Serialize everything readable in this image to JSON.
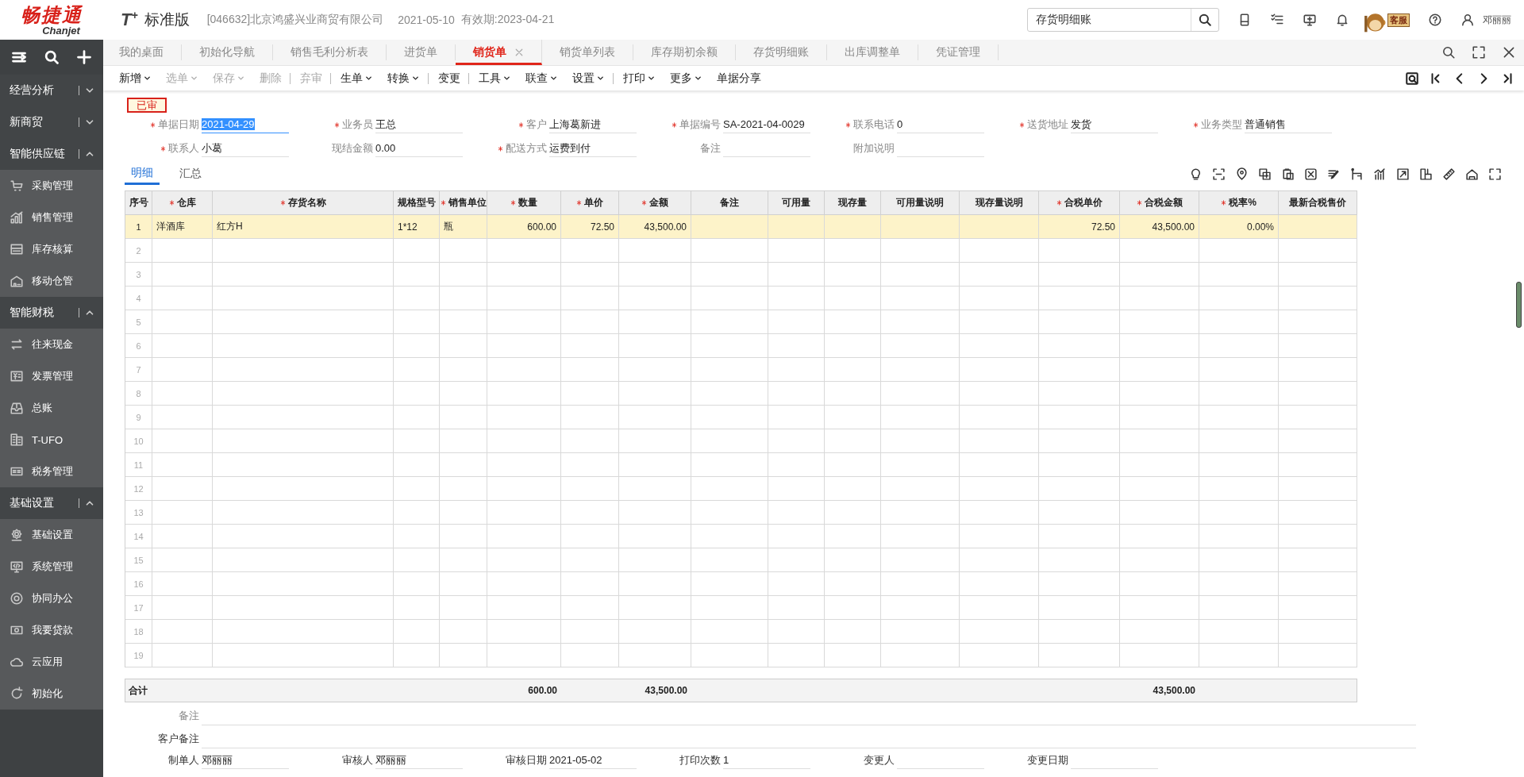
{
  "brand": {
    "name": "畅捷通",
    "latin": "Chanjet"
  },
  "product": {
    "mark": "T$^{+}$",
    "edition": "标准版"
  },
  "company": "[046632]北京鸿盛兴业商贸有限公司",
  "login_date": "2021-05-10",
  "validity": "有效期:2023-04-21",
  "search": {
    "value": "存货明细账"
  },
  "support_sign": "客服",
  "user": "邓丽丽",
  "sidebar": {
    "sections": [
      {
        "label": "经营分析",
        "expanded": false
      },
      {
        "label": "新商贸",
        "expanded": false
      },
      {
        "label": "智能供应链",
        "expanded": true,
        "items": [
          "采购管理",
          "销售管理",
          "库存核算",
          "移动仓管"
        ]
      },
      {
        "label": "智能财税",
        "expanded": true,
        "items": [
          "往来现金",
          "发票管理",
          "总账",
          "T-UFO",
          "税务管理"
        ]
      },
      {
        "label": "基础设置",
        "expanded": true,
        "items": [
          "基础设置",
          "系统管理",
          "协同办公",
          "我要贷款",
          "云应用",
          "初始化"
        ]
      }
    ]
  },
  "tabs": [
    {
      "label": "我的桌面",
      "selected": false
    },
    {
      "label": "初始化导航",
      "selected": false
    },
    {
      "label": "销售毛利分析表",
      "selected": false
    },
    {
      "label": "进货单",
      "selected": false
    },
    {
      "label": "销货单",
      "selected": true
    },
    {
      "label": "销货单列表",
      "selected": false
    },
    {
      "label": "库存期初余额",
      "selected": false
    },
    {
      "label": "存货明细账",
      "selected": false
    },
    {
      "label": "出库调整单",
      "selected": false
    },
    {
      "label": "凭证管理",
      "selected": false
    }
  ],
  "toolbar": {
    "groups": [
      [
        {
          "label": "新增",
          "dropdown": true,
          "disabled": false
        },
        {
          "label": "选单",
          "dropdown": true,
          "disabled": true
        },
        {
          "label": "保存",
          "dropdown": true,
          "disabled": true
        },
        {
          "label": "删除",
          "dropdown": false,
          "disabled": true
        }
      ],
      [
        {
          "label": "弃审",
          "dropdown": false,
          "disabled": true
        }
      ],
      [
        {
          "label": "生单",
          "dropdown": true,
          "disabled": false
        },
        {
          "label": "转换",
          "dropdown": true,
          "disabled": false
        }
      ],
      [
        {
          "label": "变更",
          "dropdown": false,
          "disabled": false
        }
      ],
      [
        {
          "label": "工具",
          "dropdown": true,
          "disabled": false
        },
        {
          "label": "联查",
          "dropdown": true,
          "disabled": false
        },
        {
          "label": "设置",
          "dropdown": true,
          "disabled": false
        }
      ],
      [
        {
          "label": "打印",
          "dropdown": true,
          "disabled": false
        },
        {
          "label": "更多",
          "dropdown": true,
          "disabled": false
        },
        {
          "label": "单据分享",
          "dropdown": false,
          "disabled": false
        }
      ]
    ]
  },
  "status_badge": "已审",
  "form": {
    "rows": [
      [
        {
          "label": "单据日期",
          "required": true,
          "value": "2021-04-29",
          "selected": true
        },
        {
          "label": "业务员",
          "required": true,
          "value": "王总",
          "selected": false
        },
        {
          "label": "客户",
          "required": true,
          "value": "上海葛新进",
          "selected": false
        },
        {
          "label": "单据编号",
          "required": true,
          "value": "SA-2021-04-0029",
          "selected": false
        },
        {
          "label": "联系电话",
          "required": true,
          "value": "0",
          "selected": false
        },
        {
          "label": "送货地址",
          "required": true,
          "value": "发货",
          "selected": false
        },
        {
          "label": "业务类型",
          "required": true,
          "value": "普通销售",
          "selected": false
        }
      ],
      [
        {
          "label": "联系人",
          "required": true,
          "value": "小葛",
          "selected": false
        },
        {
          "label": "现结金额",
          "required": false,
          "value": "0.00",
          "selected": false
        },
        {
          "label": "配送方式",
          "required": true,
          "value": "运费到付",
          "selected": false
        },
        {
          "label": "备注",
          "required": false,
          "selected": false
        },
        {
          "label": "附加说明",
          "required": false,
          "selected": false
        }
      ]
    ]
  },
  "detail_tabs": [
    {
      "label": "明细",
      "selected": true
    },
    {
      "label": "汇总",
      "selected": false
    }
  ],
  "table": {
    "columns": [
      {
        "label": "序号",
        "required": false
      },
      {
        "label": "仓库",
        "required": true,
        "numeric": false
      },
      {
        "label": "存货名称",
        "required": true,
        "numeric": false
      },
      {
        "label": "规格型号",
        "required": false,
        "numeric": false
      },
      {
        "label": "销售单位",
        "required": true,
        "numeric": false
      },
      {
        "label": "数量",
        "required": true,
        "numeric": true
      },
      {
        "label": "单价",
        "required": true,
        "numeric": true
      },
      {
        "label": "金额",
        "required": true,
        "numeric": true
      },
      {
        "label": "备注",
        "required": false
      },
      {
        "label": "可用量",
        "required": false
      },
      {
        "label": "现存量",
        "required": false
      },
      {
        "label": "可用量说明",
        "required": false
      },
      {
        "label": "现存量说明",
        "required": false
      },
      {
        "label": "合税单价",
        "required": true,
        "numeric": true
      },
      {
        "label": "合税金额",
        "required": true,
        "numeric": true
      },
      {
        "label": "税率%",
        "required": true,
        "numeric": true
      },
      {
        "label": "最新合税售价",
        "required": false
      }
    ],
    "rows": [
      {
        "selected": true,
        "cells": [
          "1",
          "洋酒库",
          "红方H",
          "1*12",
          "瓶",
          "600.00",
          "72.50",
          "43,500.00",
          null,
          null,
          null,
          null,
          null,
          "72.50",
          "43,500.00",
          "0.00%",
          null
        ]
      },
      {
        "selected": false,
        "cells": [
          "2"
        ]
      },
      {
        "selected": false,
        "cells": [
          "3"
        ]
      },
      {
        "selected": false,
        "cells": [
          "4"
        ]
      },
      {
        "selected": false,
        "cells": [
          "5"
        ]
      },
      {
        "selected": false,
        "cells": [
          "6"
        ]
      },
      {
        "selected": false,
        "cells": [
          "7"
        ]
      },
      {
        "selected": false,
        "cells": [
          "8"
        ]
      },
      {
        "selected": false,
        "cells": [
          "9"
        ]
      },
      {
        "selected": false,
        "cells": [
          "10"
        ]
      },
      {
        "selected": false,
        "cells": [
          "11"
        ]
      },
      {
        "selected": false,
        "cells": [
          "12"
        ]
      },
      {
        "selected": false,
        "cells": [
          "13"
        ]
      },
      {
        "selected": false,
        "cells": [
          "14"
        ]
      },
      {
        "selected": false,
        "cells": [
          "15"
        ]
      },
      {
        "selected": false,
        "cells": [
          "16"
        ]
      },
      {
        "selected": false,
        "cells": [
          "17"
        ]
      },
      {
        "selected": false,
        "cells": [
          "18"
        ]
      },
      {
        "selected": false,
        "cells": [
          "19"
        ]
      }
    ],
    "totals": {
      "label": "合计",
      "cells": [
        null,
        null,
        null,
        null,
        null,
        "600.00",
        null,
        "43,500.00",
        null,
        null,
        null,
        null,
        null,
        null,
        "43,500.00",
        null,
        null
      ]
    }
  },
  "notes": [
    {
      "label": "备注"
    },
    {
      "label": "客户备注"
    }
  ],
  "signoffs": [
    {
      "label": "制单人",
      "value": "邓丽丽"
    },
    {
      "label": "审核人",
      "value": "邓丽丽"
    },
    {
      "label": "审核日期",
      "value": "2021-05-02"
    },
    {
      "label": "打印次数",
      "value": "1"
    },
    {
      "label": "变更人"
    },
    {
      "label": "变更日期"
    }
  ]
}
